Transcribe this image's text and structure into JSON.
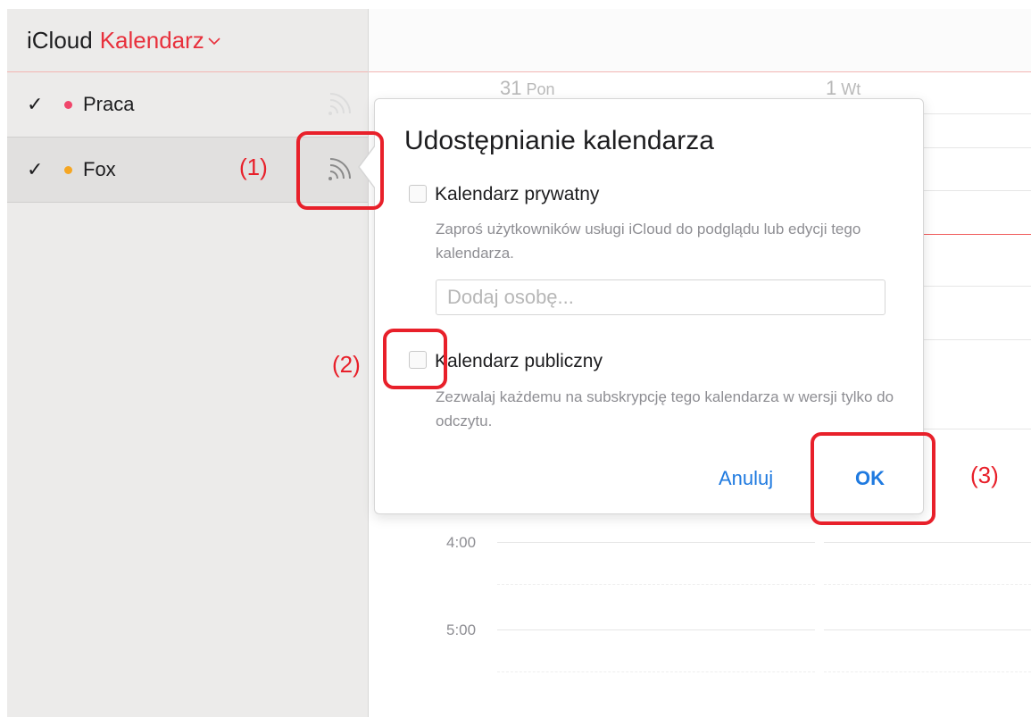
{
  "sidebar": {
    "app_name": "iCloud",
    "calendar_menu": "Kalendarz",
    "items": [
      {
        "label": "Praca",
        "checked": "✓",
        "dot_color": "#f0466b"
      },
      {
        "label": "Fox",
        "checked": "✓",
        "dot_color": "#f5a623"
      }
    ]
  },
  "main": {
    "days": [
      {
        "num": "31",
        "name": "Pon"
      },
      {
        "num": "1",
        "name": "Wt"
      }
    ],
    "times": [
      "4:00",
      "5:00"
    ]
  },
  "popover": {
    "title": "Udostępnianie kalendarza",
    "private": {
      "label": "Kalendarz prywatny",
      "desc": "Zaproś użytkowników usługi iCloud do podglądu lub edycji tego kalendarza.",
      "add_placeholder": "Dodaj osobę..."
    },
    "public": {
      "label": "Kalendarz publiczny",
      "desc": "Zezwalaj każdemu na subskrypcję tego kalendarza w wersji tylko do odczytu."
    },
    "cancel_label": "Anuluj",
    "ok_label": "OK"
  },
  "annotations": [
    "(1)",
    "(2)",
    "(3)"
  ],
  "colors": {
    "accent": "#e8303c",
    "link": "#1f7ae0",
    "annotation": "#e8202a"
  }
}
